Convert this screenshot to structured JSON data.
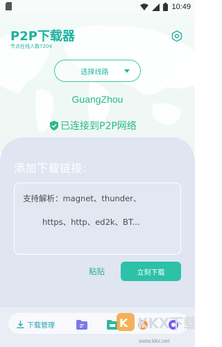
{
  "status_bar": {
    "time": "10:49"
  },
  "header": {
    "app_title": "P2P下载器",
    "node_count": "节点在线人数7204",
    "line_select_label": "选择线路",
    "city": "GuangZhou",
    "connection_status": "已连接到P2P网络"
  },
  "card": {
    "title": "添加下载链接:",
    "placeholder_line1": "支持解析：magnet、thunder、",
    "placeholder_line2": "https、http、ed2k、BT...",
    "paste_label": "粘贴",
    "download_label": "立刻下载"
  },
  "bottom": {
    "manage_label": "下载管理"
  },
  "watermark": {
    "site": "www.kkx.net",
    "logo_text": "KKX下载"
  },
  "colors": {
    "accent": "#2cc1a8",
    "title_green": "#1fb1a0",
    "card_bg": "#dfe5f1"
  }
}
